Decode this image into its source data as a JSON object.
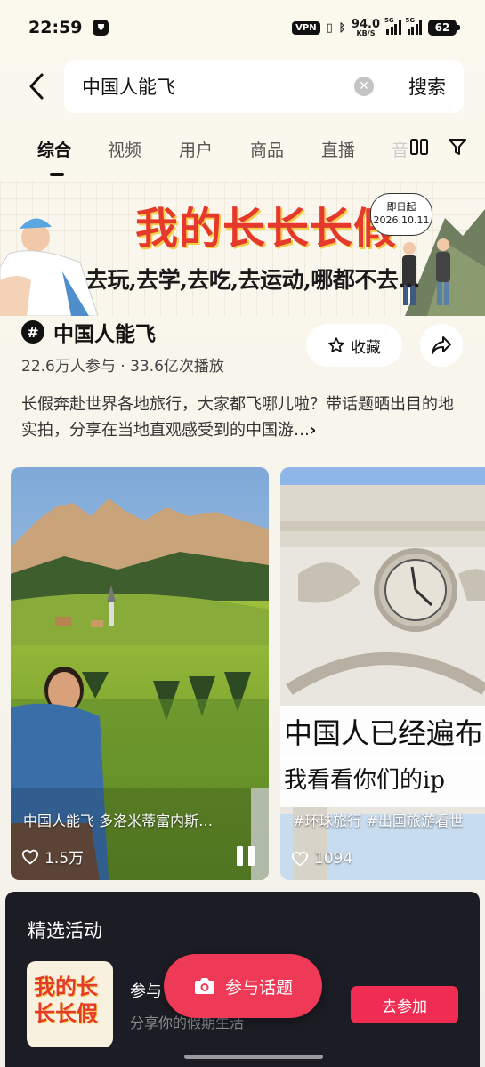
{
  "status_bar": {
    "time": "22:59",
    "vpn": "VPN",
    "net_speed": "94.0",
    "net_unit": "KB/S",
    "sig1_label": "5G",
    "sig2_label": "5G",
    "battery": "62"
  },
  "search": {
    "query": "中国人能飞",
    "button": "搜索"
  },
  "tabs": [
    "综合",
    "视频",
    "用户",
    "商品",
    "直播"
  ],
  "tab_partial": "音",
  "banner": {
    "title": "我的长长长假",
    "subtitle": "去玩,去学,去吃,去运动,哪都不去...",
    "bubble_line1": "即日起",
    "bubble_line2": "2026.10.11"
  },
  "topic": {
    "name": "中国人能飞",
    "stats": "22.6万人参与 · 33.6亿次播放",
    "favorite_label": "收藏",
    "description": "长假奔赴世界各地旅行，大家都飞哪儿啦？带话题晒出目的地实拍，分享在当地直观感受到的中国游…",
    "more_icon": "›"
  },
  "cards": [
    {
      "title": "中国人能飞 多洛米蒂富内斯…",
      "likes": "1.5万"
    },
    {
      "title": "#环球旅行 #出国旅游看世",
      "likes": "1094",
      "overlay1": "中国人已经遍布",
      "overlay2": "我看看你们的ip"
    }
  ],
  "activity_panel": {
    "title": "精选活动",
    "name": "参与",
    "subtitle": "分享你的假期生活",
    "join_label": "去参加",
    "thumb_text": "我的长长长假"
  },
  "fab_label": "参与话题",
  "colors": {
    "accent": "#ef3a57",
    "panel_bg": "#1c1d24",
    "banner_red": "#e53a2b"
  }
}
